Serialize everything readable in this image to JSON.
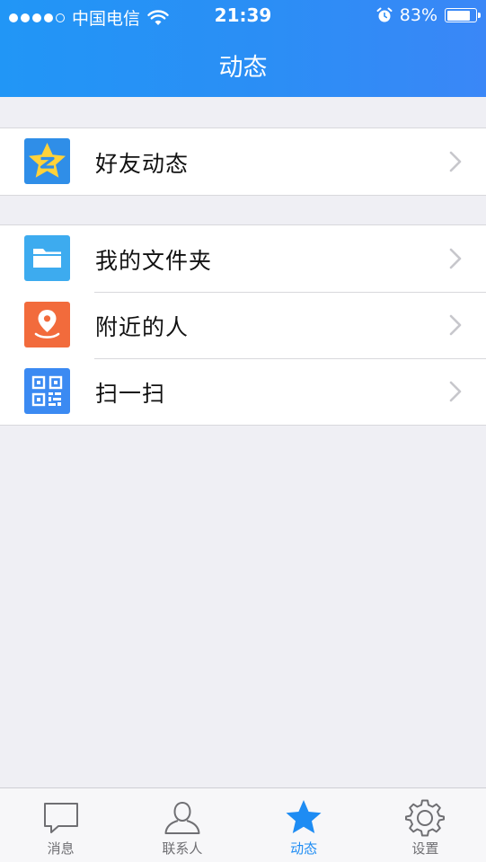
{
  "status_bar": {
    "carrier": "中国电信",
    "time": "21:39",
    "battery_percent_text": "83%",
    "battery_level": 0.83
  },
  "nav": {
    "title": "动态"
  },
  "groups": [
    {
      "items": [
        {
          "label": "好友动态",
          "icon": "qzone-star-icon",
          "icon_bg": "#2f8ee8"
        }
      ]
    },
    {
      "items": [
        {
          "label": "我的文件夹",
          "icon": "folder-icon",
          "icon_bg": "#3dabef"
        },
        {
          "label": "附近的人",
          "icon": "location-pin-icon",
          "icon_bg": "#f26b3c"
        },
        {
          "label": "扫一扫",
          "icon": "qr-code-icon",
          "icon_bg": "#3b8af2"
        }
      ]
    }
  ],
  "tab_bar": {
    "active": 2,
    "items": [
      {
        "label": "消息",
        "icon": "chat-bubble-icon"
      },
      {
        "label": "联系人",
        "icon": "contact-person-icon"
      },
      {
        "label": "动态",
        "icon": "star-icon"
      },
      {
        "label": "设置",
        "icon": "gear-icon"
      }
    ]
  },
  "colors": {
    "header_blue": "#2196f6",
    "accent_blue": "#1e8cf3",
    "background": "#efeff4"
  }
}
